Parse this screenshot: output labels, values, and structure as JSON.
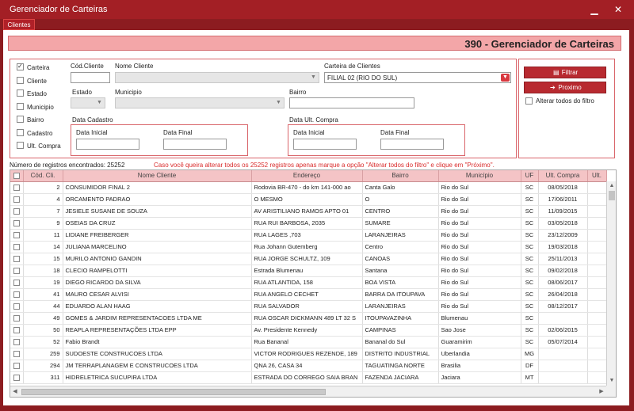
{
  "window": {
    "title": "Gerenciador de Carteiras",
    "minimize": "▁",
    "close": "✕"
  },
  "tabs": [
    {
      "label": "Clientes"
    }
  ],
  "header": {
    "title": "390 - Gerenciador de Carteiras"
  },
  "filters": {
    "checkboxes": [
      {
        "label": "Carteira",
        "checked": true
      },
      {
        "label": "Cliente",
        "checked": false
      },
      {
        "label": "Estado",
        "checked": false
      },
      {
        "label": "Municipio",
        "checked": false
      },
      {
        "label": "Bairro",
        "checked": false
      },
      {
        "label": "Cadastro",
        "checked": false
      },
      {
        "label": "Ult. Compra",
        "checked": false
      }
    ],
    "cod_cliente_label": "Cód.Cliente",
    "nome_cliente_label": "Nome Cliente",
    "carteira_label": "Carteira de Clientes",
    "carteira_value": "FILIAL 02 (RIO DO SUL)",
    "estado_label": "Estado",
    "municipio_label": "Municipio",
    "bairro_label": "Bairro",
    "data_cadastro_label": "Data Cadastro",
    "data_ult_compra_label": "Data Ult. Compra",
    "data_inicial_label": "Data Inicial",
    "data_final_label": "Data Final"
  },
  "actions": {
    "filtrar": "Filtrar",
    "proximo": "Proximo",
    "alterar_todos": "Alterar todos do filtro"
  },
  "status": {
    "count": "Número de registros encontrados: 25252",
    "hint": "Caso você queira alterar todos os 25252 registros apenas marque a opção \"Alterar todos do filtro\" e clique em \"Próximo\"."
  },
  "grid": {
    "columns": [
      "Cód. Cli.",
      "Nome Cliente",
      "Endereço",
      "Bairro",
      "Município",
      "UF",
      "Ult. Compra",
      "Ult."
    ],
    "rows": [
      [
        "2",
        "CONSUMIDOR FINAL 2",
        "Rodovia BR-470 - do km 141-000 ao",
        "Canta Galo",
        "Rio do Sul",
        "SC",
        "08/05/2018"
      ],
      [
        "4",
        "ORCAMENTO PADRAO",
        "O MESMO",
        "O",
        "Rio do Sul",
        "SC",
        "17/06/2011"
      ],
      [
        "7",
        "JESIELE SUSANE DE SOUZA",
        "AV ARISTILIANO RAMOS APTO 01",
        "CENTRO",
        "Rio do Sul",
        "SC",
        "11/09/2015"
      ],
      [
        "9",
        "OSEIAS DA CRUZ",
        "RUA RUI BARBOSA, 2035",
        "SUMARE",
        "Rio do Sul",
        "SC",
        "03/05/2018"
      ],
      [
        "11",
        "LIDIANE FREIBERGER",
        "RUA LAGES ,703",
        "LARANJEIRAS",
        "Rio do Sul",
        "SC",
        "23/12/2009"
      ],
      [
        "14",
        "JULIANA MARCELINO",
        "Rua Johann Gutemberg",
        "Centro",
        "Rio do Sul",
        "SC",
        "19/03/2018"
      ],
      [
        "15",
        "MURILO ANTONIO GANDIN",
        "RUA JORGE SCHULTZ, 109",
        "CANOAS",
        "Rio do Sul",
        "SC",
        "25/11/2013"
      ],
      [
        "18",
        "CLECIO RAMPELOTTI",
        "Estrada Blumenau",
        "Santana",
        "Rio do Sul",
        "SC",
        "09/02/2018"
      ],
      [
        "19",
        "DIEGO RICARDO DA SILVA",
        "RUA ATLANTIDA, 158",
        "BOA VISTA",
        "Rio do Sul",
        "SC",
        "08/06/2017"
      ],
      [
        "41",
        "MAURO CESAR ALVISI",
        "RUA ANGELO CECHET",
        "BARRA DA ITOUPAVA",
        "Rio do Sul",
        "SC",
        "26/04/2018"
      ],
      [
        "44",
        "EDUARDO ALAN HAAG",
        "RUA SALVADOR",
        "LARANJEIRAS",
        "Rio do Sul",
        "SC",
        "08/12/2017"
      ],
      [
        "49",
        "GOMES & JARDIM REPRESENTACOES LTDA ME",
        "RUA OSCAR DICKMANN 489 LT 32 S",
        "ITOUPAVAZINHA",
        "Blumenau",
        "SC",
        ""
      ],
      [
        "50",
        "REAPLA REPRESENTAÇÕES LTDA EPP",
        "Av. Presidente Kennedy",
        "CAMPINAS",
        "Sao Jose",
        "SC",
        "02/06/2015"
      ],
      [
        "52",
        "Fabio Brandt",
        "Rua Bananal",
        "Bananal do Sul",
        "Guaramirim",
        "SC",
        "05/07/2014"
      ],
      [
        "259",
        "SUDOESTE CONSTRUCOES LTDA",
        "VICTOR RODRIGUES REZENDE, 189",
        "DISTRITO INDUSTRIAL",
        "Uberlandia",
        "MG",
        ""
      ],
      [
        "294",
        "JM TERRAPLANAGEM E CONSTRUCOES LTDA",
        "QNA 26, CASA 34",
        "TAGUATINGA NORTE",
        "Brasilia",
        "DF",
        ""
      ],
      [
        "311",
        "HIDRELETRICA SUCUPIRA LTDA",
        "ESTRADA DO CORREGO SAIA BRAN",
        "FAZENDA JACIARA",
        "Jaciara",
        "MT",
        ""
      ]
    ]
  }
}
